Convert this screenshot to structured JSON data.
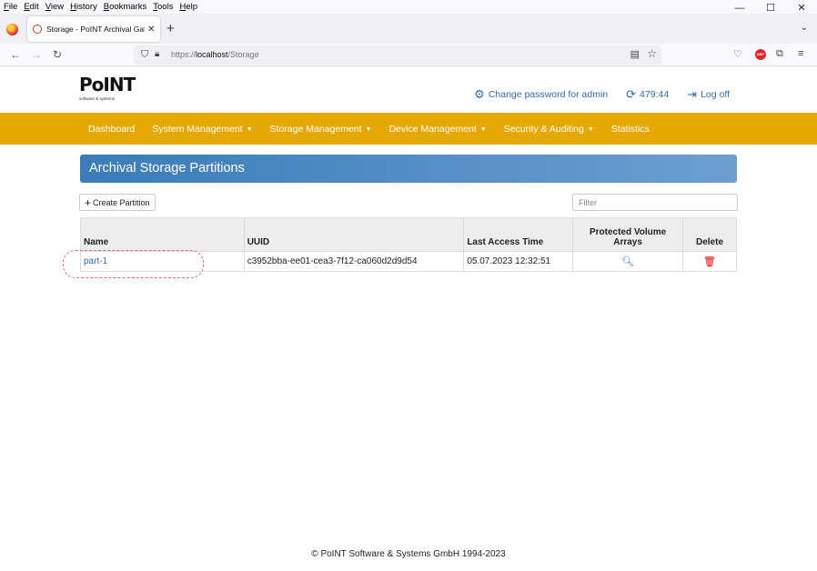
{
  "menubar": {
    "items": [
      "File",
      "Edit",
      "View",
      "History",
      "Bookmarks",
      "Tools",
      "Help"
    ],
    "underlines": [
      "F",
      "E",
      "V",
      "H",
      "B",
      "T",
      "H"
    ]
  },
  "window": {
    "minimize": "—",
    "maximize": "☐",
    "close": "✕"
  },
  "tab": {
    "title": "Storage - PoINT Archival Gatew",
    "close": "✕"
  },
  "browser": {
    "url_prefix": "https://",
    "url_host": "localhost",
    "url_path": "/Storage"
  },
  "header": {
    "logo_main": "PoINT",
    "logo_sub": "software & systems",
    "change_password": "Change password for admin",
    "session_timer": "479:44",
    "log_off": "Log off"
  },
  "nav": {
    "items": [
      {
        "label": "Dashboard",
        "dropdown": false
      },
      {
        "label": "System Management",
        "dropdown": true
      },
      {
        "label": "Storage Management",
        "dropdown": true
      },
      {
        "label": "Device Management",
        "dropdown": true
      },
      {
        "label": "Security & Auditing",
        "dropdown": true
      },
      {
        "label": "Statistics",
        "dropdown": false
      }
    ]
  },
  "panel": {
    "title": "Archival Storage Partitions"
  },
  "toolbar": {
    "create_label": "Create Partition",
    "filter_placeholder": "Filter"
  },
  "table": {
    "headers": {
      "name": "Name",
      "uuid": "UUID",
      "last_access": "Last Access Time",
      "pva_line1": "Protected Volume",
      "pva_line2": "Arrays",
      "delete": "Delete"
    },
    "rows": [
      {
        "name": "part-1",
        "uuid": "c3952bba-ee01-cea3-7f12-ca060d2d9d54",
        "last_access": "05.07.2023 12:32:51"
      }
    ]
  },
  "footer": {
    "text": "© PoINT Software & Systems GmbH 1994-2023"
  },
  "colors": {
    "nav_bg": "#e5a800",
    "panel_start": "#3a7cb8",
    "panel_end": "#6b9fd0",
    "link": "#2a6ebb",
    "delete": "#ee0000"
  }
}
